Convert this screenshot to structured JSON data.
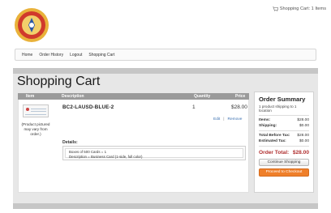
{
  "header": {
    "cart_link": "Shopping Cart:  1 Items"
  },
  "nav": {
    "items": [
      "Home",
      "Order History",
      "Logout",
      "Shopping Cart"
    ]
  },
  "page": {
    "title": "Shopping Cart"
  },
  "table": {
    "headers": {
      "item": "Item",
      "description": "Description",
      "quantity": "Quantity",
      "price": "Price"
    },
    "rows": [
      {
        "name": "BC2-LAUSD-BLUE-2",
        "quantity": "1",
        "price": "$28.00",
        "edit": "Edit",
        "separator": "|",
        "remove": "Remove",
        "product_note": "(Product pictured may vary from order.)",
        "details_label": "Details:",
        "details": [
          "Boxes of 500 Cards = 1",
          "Description = Business Card (1-side, full color)"
        ]
      }
    ]
  },
  "summary": {
    "title": "Order Summary",
    "subtitle": "1 product shipping to 1 location",
    "items_label": "Items:",
    "items_value": "$28.00",
    "shipping_label": "Shipping:",
    "shipping_value": "$0.00",
    "before_tax_label": "Total Before Tax:",
    "before_tax_value": "$28.00",
    "est_tax_label": "Estimated Tax:",
    "est_tax_value": "$0.00",
    "total_label": "Order Total:",
    "total_value": "$28.00",
    "continue_label": "Continue Shopping",
    "checkout_label": "Proceed to Checkout"
  },
  "colors": {
    "accent_orange": "#ef7f2a",
    "total_red": "#b03030",
    "link_blue": "#3a6fb0"
  }
}
